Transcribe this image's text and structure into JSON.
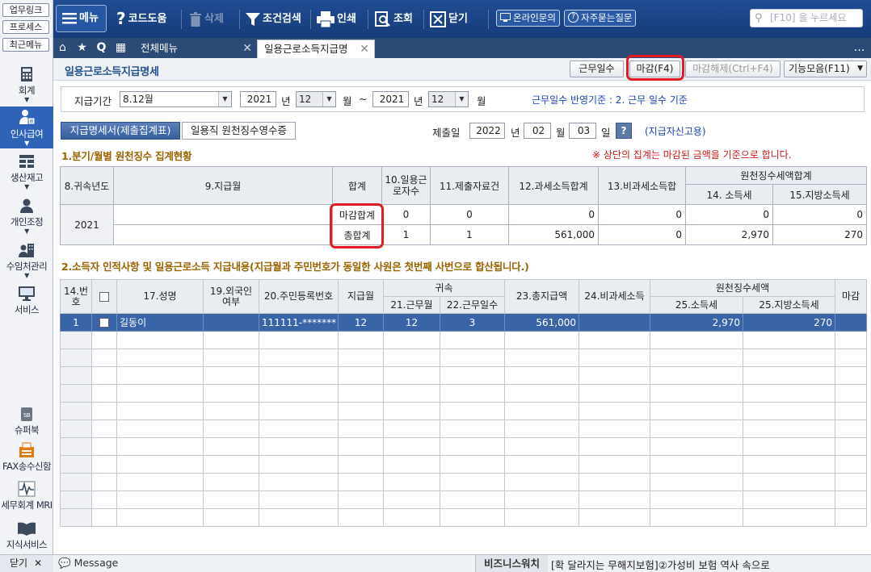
{
  "left_rail": {
    "quick": [
      "업무링크",
      "프로세스",
      "최근메뉴"
    ],
    "nav": [
      {
        "label": "회계",
        "icon": "calculator-icon"
      },
      {
        "label": "인사급여",
        "icon": "person-icon"
      },
      {
        "label": "생산재고",
        "icon": "grid-icon"
      },
      {
        "label": "개인조정",
        "icon": "user-icon"
      },
      {
        "label": "수임처관리",
        "icon": "building-icon"
      },
      {
        "label": "서비스",
        "icon": "monitor-icon"
      }
    ],
    "bottom": [
      {
        "label": "슈퍼북",
        "icon": "book-icon"
      },
      {
        "label": "FAX송수신함",
        "icon": "fax-icon"
      },
      {
        "label": "세무회계 MRI",
        "icon": "pulse-icon"
      },
      {
        "label": "지식서비스",
        "icon": "open-book-icon"
      }
    ],
    "close_label": "닫기"
  },
  "toolbar": {
    "menu": "메뉴",
    "code_help": "코드도움",
    "delete": "삭제",
    "filter_search": "조건검색",
    "print": "인쇄",
    "lookup": "조회",
    "close": "닫기",
    "online_inquiry": "온라인문의",
    "faq": "자주묻는질문",
    "search_placeholder": "[F10] 을 누르세요"
  },
  "tabs": {
    "all_menu": "전체메뉴",
    "active": "일용근로소득지급명"
  },
  "page": {
    "title": "일용근로소득지급명세",
    "btn_work_days": "근무일수",
    "btn_close_f4": "마감(F4)",
    "btn_unclose": "마감해제(Ctrl+F4)",
    "btn_functions": "기능모음(F11)"
  },
  "filter": {
    "period_label": "지급기간",
    "period_value": "8.12월",
    "year_from": "2021",
    "year_unit": "년",
    "month_from": "12",
    "month_unit": "월",
    "tilde": "~",
    "year_to": "2021",
    "month_to": "12",
    "basis_note": "근무일수 반영기준 : 2. 근무 일수 기준"
  },
  "subtabs": [
    "지급명세서(제출집계표)",
    "일용직 원천징수영수증"
  ],
  "submit": {
    "label": "제출일",
    "year": "2022",
    "year_unit": "년",
    "month": "02",
    "month_unit": "월",
    "day": "03",
    "day_unit": "일",
    "help": "?",
    "note": "(지급자신고용)"
  },
  "section1": {
    "title": "1.분기/월별 원천징수 집계현황",
    "warning": "※ 상단의 집계는 마감된 금액을 기준으로 합니다.",
    "headers": {
      "year": "8.귀속년도",
      "month": "9.지급월",
      "total": "합계",
      "workers": "10.일용근로자수",
      "submits": "11.제출자료건",
      "taxable": "12.과세소득합계",
      "nontax": "13.비과세소득합",
      "withholding": "원천징수세액합계",
      "income_tax": "14. 소득세",
      "local_tax": "15.지방소득세"
    },
    "rows": [
      {
        "year": "2021",
        "total": "마감합계",
        "workers": "0",
        "submits": "0",
        "taxable": "0",
        "nontax": "0",
        "income_tax": "0",
        "local_tax": "0"
      },
      {
        "total": "총합계",
        "workers": "1",
        "submits": "1",
        "taxable": "561,000",
        "nontax": "0",
        "income_tax": "2,970",
        "local_tax": "270"
      }
    ]
  },
  "section2": {
    "title": "2.소득자 인적사항 및 일용근로소득 지급내용(지급월과 주민번호가 동일한 사원은 첫번째 사번으로 합산됩니다.)",
    "headers": {
      "no": "14.번호",
      "name": "17.성명",
      "foreign": "19.외국인여부",
      "rrn": "20.주민등록번호",
      "pay_month": "지급월",
      "attribution": "귀속",
      "work_month": "21.근무월",
      "work_days": "22.근무일수",
      "total_pay": "23.총지급액",
      "nontax": "24.비과세소득",
      "withholding": "원천징수세액",
      "income_tax": "25.소득세",
      "local_tax": "25.지방소득세",
      "closed": "마감"
    },
    "rows": [
      {
        "no": "1",
        "name": "길동이",
        "foreign": "",
        "rrn": "111111-*******",
        "pay_month": "12",
        "work_month": "12",
        "work_days": "3",
        "total_pay": "561,000",
        "nontax": "",
        "income_tax": "2,970",
        "local_tax": "270",
        "closed": ""
      }
    ]
  },
  "status": {
    "message": "Message",
    "news_label": "비즈니스워치",
    "news": "[확 달라지는 무해지보험]②가성비 보험 역사 속으로"
  }
}
